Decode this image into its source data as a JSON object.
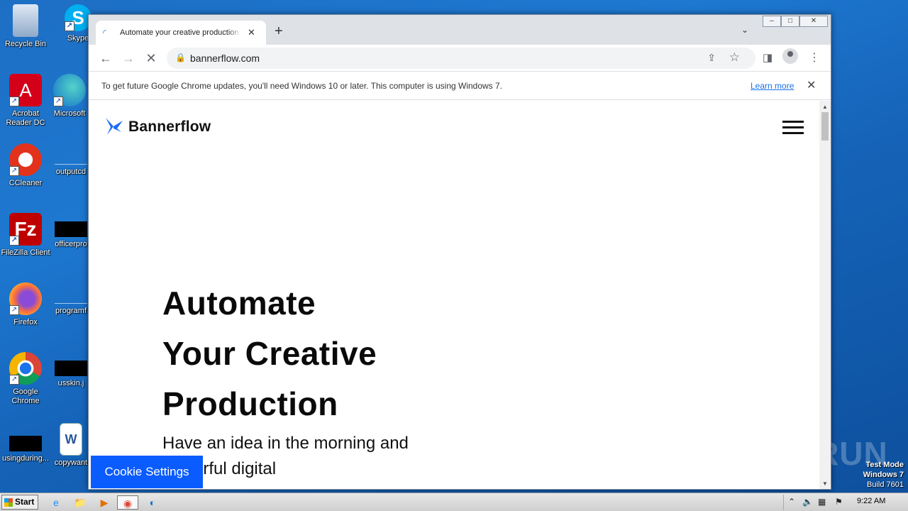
{
  "desktop": {
    "icons": [
      {
        "label": "Recycle Bin"
      },
      {
        "label": "Skype"
      },
      {
        "label": "Acrobat Reader DC"
      },
      {
        "label": "Microsoft"
      },
      {
        "label": "CCleaner"
      },
      {
        "label": "outputcd"
      },
      {
        "label": "FileZilla Client"
      },
      {
        "label": "officerpro"
      },
      {
        "label": "Firefox"
      },
      {
        "label": "programf"
      },
      {
        "label": "Google Chrome"
      },
      {
        "label": "usskin.j"
      },
      {
        "label": "usingduring..."
      },
      {
        "label": "copywant"
      }
    ],
    "watermark": "ANY RUN",
    "test_mode": {
      "line1": "Test Mode",
      "line2": "Windows 7",
      "line3": "Build 7601"
    }
  },
  "browser": {
    "tab": {
      "title": "Automate your creative production c",
      "close": "✕"
    },
    "new_tab": "+",
    "tab_search": "⌄",
    "window_controls": {
      "minimize": "–",
      "maximize": "□",
      "close": "✕"
    },
    "nav": {
      "back": "←",
      "forward": "→",
      "reload": "✕"
    },
    "address": {
      "url": "bannerflow.com"
    },
    "infobar": {
      "message": "To get future Google Chrome updates, you'll need Windows 10 or later. This computer is using Windows 7.",
      "link": "Learn more",
      "close": "✕"
    }
  },
  "page": {
    "brand": "Bannerflow",
    "hero_lines": [
      "Automate",
      "Your Creative",
      "Production"
    ],
    "subtitle": "Have an idea in the morning and powerful digital",
    "cookie_button": "Cookie Settings"
  },
  "taskbar": {
    "start": "Start",
    "clock": "9:22 AM"
  },
  "colors": {
    "cookie_button": "#0a5cff",
    "link": "#1a73e8",
    "desktop": "#1e78d0"
  }
}
